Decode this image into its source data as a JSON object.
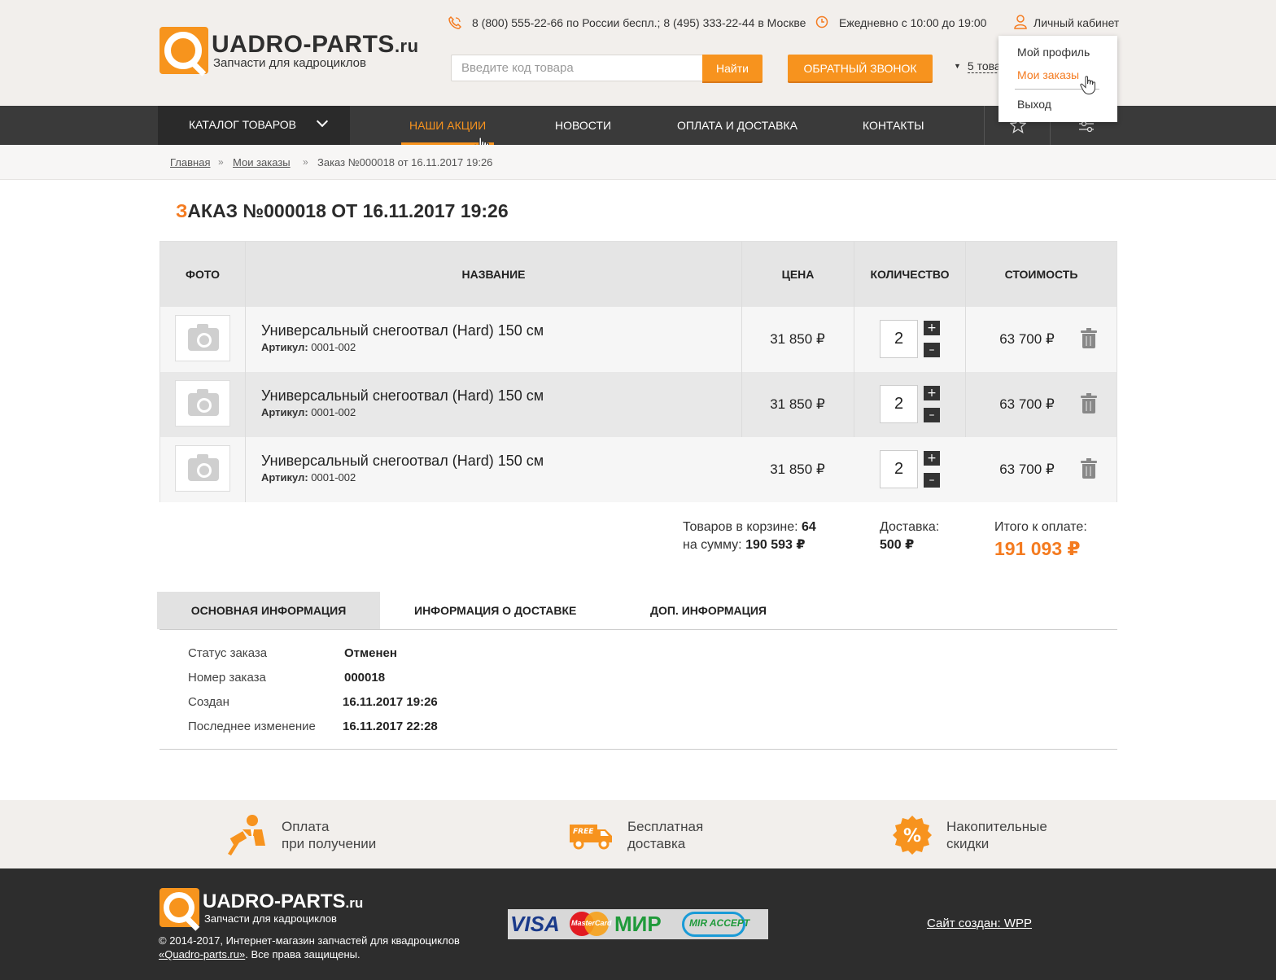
{
  "header": {
    "logo_title": "UADRO-PARTS",
    "logo_domain": ".ru",
    "logo_subtitle": "Запчасти для кадроциклов",
    "phone1": "8 (800) 555-22-66",
    "phone1_note": "по России беспл.;",
    "phone2": "8 (495) 333-22-44",
    "phone2_note": "в Москве",
    "hours": "Ежедневно с 10:00 до 19:00",
    "account_label": "Личный кабинет",
    "search_placeholder": "Введите код товара",
    "search_button": "Найти",
    "callback_button": "ОБРАТНЫЙ ЗВОНОК",
    "cart_link": "5 това"
  },
  "user_menu": {
    "items": [
      {
        "label": "Мой профиль",
        "active": false
      },
      {
        "label": "Мои заказы",
        "active": true
      },
      {
        "label": "Выход",
        "active": false
      }
    ]
  },
  "nav": {
    "catalog": "КАТАЛОГ ТОВАРОВ",
    "items": [
      "НАШИ АКЦИИ",
      "НОВОСТИ",
      "ОПЛАТА И ДОСТАВКА",
      "КОНТАКТЫ"
    ],
    "active_index": 0
  },
  "breadcrumb": {
    "home": "Главная",
    "orders": "Мои заказы",
    "current": "Заказ №000018 от 16.11.2017 19:26",
    "separator": "»"
  },
  "page": {
    "title_first": "З",
    "title_rest": "АКАЗ №000018 ОТ 16.11.2017 19:26"
  },
  "table": {
    "headers": [
      "ФОТО",
      "НАЗВАНИЕ",
      "ЦЕНА",
      "КОЛИЧЕСТВО",
      "СТОИМОСТЬ"
    ],
    "article_label": "Артикул:",
    "rows": [
      {
        "name": "Универсальный снегоотвал (Hard) 150 см",
        "article": "0001-002",
        "price": "31 850 ₽",
        "qty": "2",
        "cost": "63 700 ₽"
      },
      {
        "name": "Универсальный снегоотвал (Hard) 150 см",
        "article": "0001-002",
        "price": "31 850 ₽",
        "qty": "2",
        "cost": "63 700 ₽"
      },
      {
        "name": "Универсальный снегоотвал (Hard) 150 см",
        "article": "0001-002",
        "price": "31 850 ₽",
        "qty": "2",
        "cost": "63 700 ₽"
      }
    ],
    "plus": "+",
    "minus": "–"
  },
  "summary": {
    "items_label": "Товаров в корзине:",
    "items_count": "64",
    "sum_label": "на сумму:",
    "sum_value": "190 593 ₽",
    "delivery_label": "Доставка:",
    "delivery_value": "500 ₽",
    "total_label": "Итого к оплате:",
    "total_value": "191 093 ₽"
  },
  "tabs": {
    "items": [
      "ОСНОВНАЯ ИНФОРМАЦИЯ",
      "ИНФОРМАЦИЯ О ДОСТАВКЕ",
      "ДОП. ИНФОРМАЦИЯ"
    ],
    "active_index": 0
  },
  "info": [
    {
      "label": "Статус заказа",
      "value": "Отменен"
    },
    {
      "label": "Номер заказа",
      "value": "000018"
    },
    {
      "label": "Создан",
      "value": "16.11.2017 19:26"
    },
    {
      "label": "Последнее изменение",
      "value": "16.11.2017 22:28"
    }
  ],
  "features": [
    {
      "line1": "Оплата",
      "line2": "при получении",
      "icon": "payment-icon"
    },
    {
      "line1": "Бесплатная",
      "line2": "доставка",
      "icon": "free-delivery-truck-icon",
      "badge": "FREE"
    },
    {
      "line1": "Накопительные",
      "line2": "скидки",
      "icon": "discount-percent-icon",
      "badge": "%"
    }
  ],
  "footer": {
    "logo_title": "UADRO-PARTS",
    "logo_domain": ".ru",
    "logo_subtitle": "Запчасти для кадроциклов",
    "copyright_line1": "© 2014-2017, Интернет-магазин запчастей для квадроциклов",
    "copyright_link": "«Quadro-parts.ru»",
    "copyright_line2_rest": ". Все права защищены.",
    "payments": [
      "VISA",
      "MasterCard",
      "МИР",
      "MIR ACCEPT"
    ],
    "made_by": "Сайт создан:  WPP"
  },
  "colors": {
    "accent": "#f7931e",
    "nav_bg": "#3a3a3a",
    "footer_bg": "#2d2d2d",
    "header_bg": "#f2efec"
  }
}
